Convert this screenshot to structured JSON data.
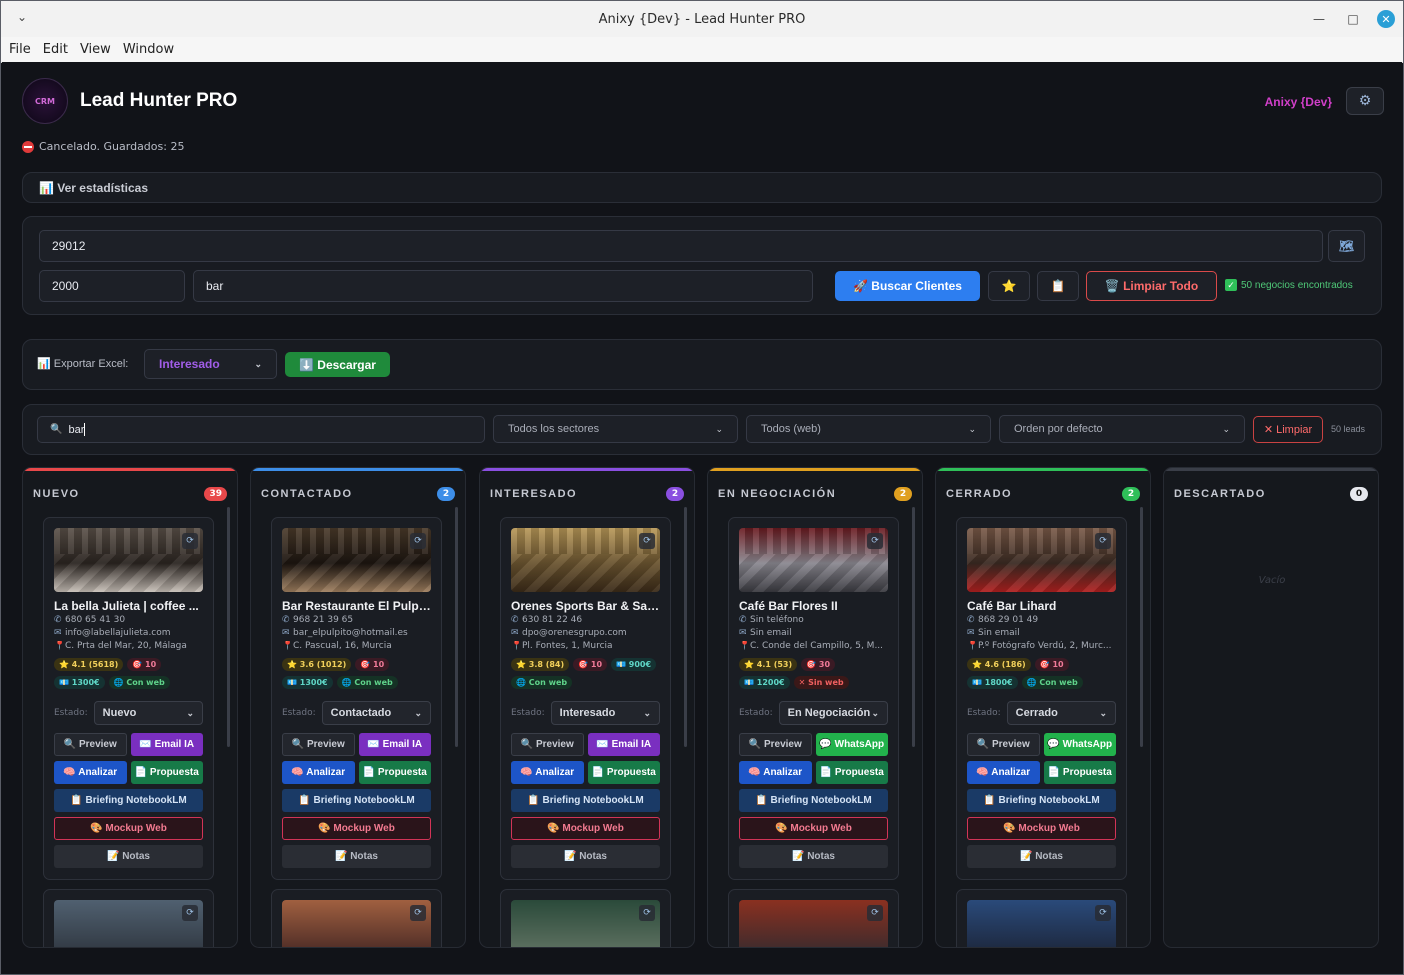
{
  "window": {
    "title": "Anixy {Dev} - Lead Hunter PRO",
    "controls": [
      "—",
      "□",
      "✕"
    ]
  },
  "menu": [
    "File",
    "Edit",
    "View",
    "Window"
  ],
  "app": {
    "logo_text": "CRM",
    "title": "Lead Hunter PRO",
    "user": "Anixy {Dev}",
    "status": "Cancelado. Guardados: 25"
  },
  "stats": {
    "label": "📊 Ver estadísticas"
  },
  "search": {
    "location": "29012",
    "radius": "2000",
    "query": "bar",
    "search_btn": "🚀 Buscar Clientes",
    "fav_btn": "⭐",
    "copy_btn": "📋",
    "clear_btn": "🗑️ Limpiar Todo",
    "found": "50 negocios encontrados"
  },
  "export": {
    "label": "📊 Exportar Excel:",
    "select": "Interesado",
    "download": "⬇️ Descargar"
  },
  "filters": {
    "search_value": "bar",
    "sector": "Todos los sectores",
    "web": "Todos (web)",
    "order": "Orden por defecto",
    "clear": "✕ Limpiar",
    "leads": "50 leads"
  },
  "colors": {
    "nuevo": "#e8484a",
    "contactado": "#3d8ee8",
    "interesado": "#8a4fe0",
    "negociacion": "#e0a020",
    "cerrado": "#2fbf59",
    "descartado": "#3a3e48"
  },
  "columns": [
    {
      "title": "NUEVO",
      "count": "39",
      "card": {
        "name": "La bella Julieta | coffee ...",
        "phone": "680 65 41 30",
        "email": "info@labellajulieta.com",
        "address": "C. Prta del Mar, 20, Málaga",
        "rating": "⭐ 4.1 (5618)",
        "score": "🎯 10",
        "price": "💶 1300€",
        "web": "🌐 Con web",
        "web_ok": true,
        "estado": "Nuevo",
        "contact_btn": "✉️ Email IA",
        "contact_type": "email"
      }
    },
    {
      "title": "CONTACTADO",
      "count": "2",
      "card": {
        "name": "Bar Restaurante El Pulpito",
        "phone": "968 21 39 65",
        "email": "bar_elpulpito@hotmail.es",
        "address": "C. Pascual, 16, Murcia",
        "rating": "⭐ 3.6 (1012)",
        "score": "🎯 10",
        "price": "💶 1300€",
        "web": "🌐 Con web",
        "web_ok": true,
        "estado": "Contactado",
        "contact_btn": "✉️ Email IA",
        "contact_type": "email"
      }
    },
    {
      "title": "INTERESADO",
      "count": "2",
      "card": {
        "name": "Orenes Sports Bar & Sal...",
        "phone": "630 81 22 46",
        "email": "dpo@orenesgrupo.com",
        "address": "Pl. Fontes, 1, Murcia",
        "rating": "⭐ 3.8 (84)",
        "score": "🎯 10",
        "price": "💶 900€",
        "web": "🌐 Con web",
        "web_ok": true,
        "estado": "Interesado",
        "contact_btn": "✉️ Email IA",
        "contact_type": "email"
      }
    },
    {
      "title": "EN NEGOCIACIÓN",
      "count": "2",
      "card": {
        "name": "Café Bar Flores II",
        "phone": "Sin teléfono",
        "email": "Sin email",
        "address": "C. Conde del Campillo, 5, M...",
        "rating": "⭐ 4.1 (53)",
        "score": "🎯 30",
        "price": "💶 1200€",
        "web": "✕ Sin web",
        "web_ok": false,
        "estado": "En Negociación",
        "contact_btn": "💬 WhatsApp",
        "contact_type": "wa"
      }
    },
    {
      "title": "CERRADO",
      "count": "2",
      "card": {
        "name": "Café Bar Lihard",
        "phone": "868 29 01 49",
        "email": "Sin email",
        "address": "P.º Fotógrafo Verdú, 2, Murc...",
        "rating": "⭐ 4.6 (186)",
        "score": "🎯 10",
        "price": "💶 1800€",
        "web": "🌐 Con web",
        "web_ok": true,
        "estado": "Cerrado",
        "contact_btn": "💬 WhatsApp",
        "contact_type": "wa"
      }
    },
    {
      "title": "DESCARTADO",
      "count": "0",
      "empty": "Vacío"
    }
  ],
  "card_labels": {
    "estado": "Estado:",
    "preview": "🔍 Preview",
    "analizar": "🧠 Analizar",
    "propuesta": "📄 Propuesta",
    "briefing": "📋 Briefing NotebookLM",
    "mockup": "🎨 Mockup Web",
    "notas": "📝 Notas"
  }
}
